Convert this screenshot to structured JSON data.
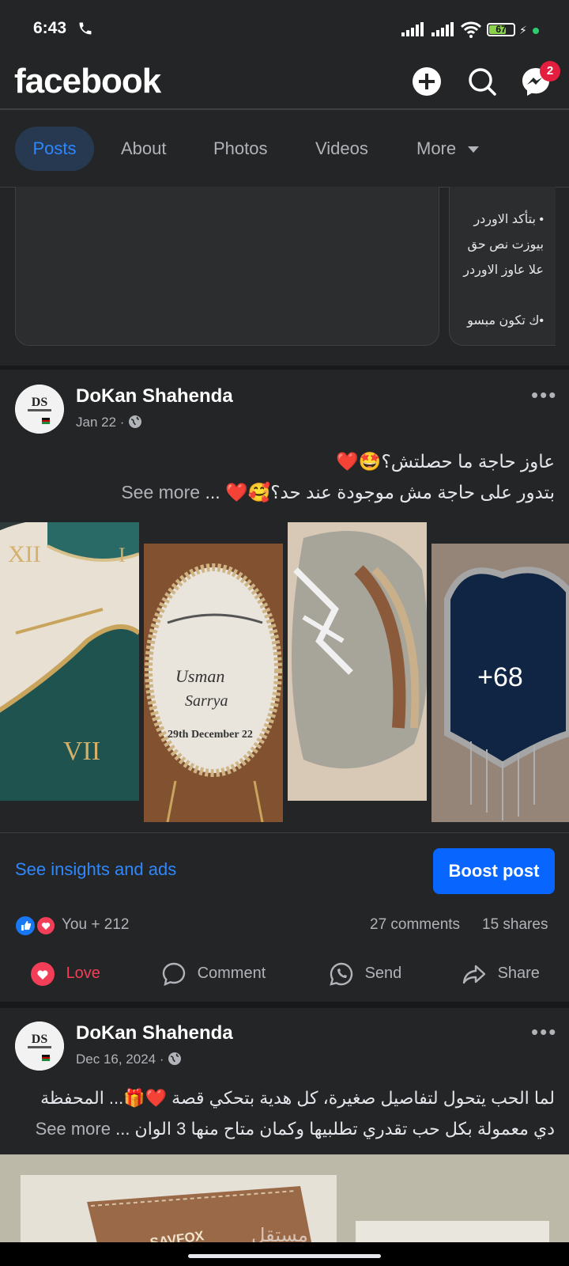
{
  "status_bar": {
    "time": "6:43",
    "battery": "67"
  },
  "header": {
    "logo": "facebook",
    "messenger_badge": "2"
  },
  "tabs": [
    {
      "label": "Posts"
    },
    {
      "label": "About"
    },
    {
      "label": "Photos"
    },
    {
      "label": "Videos"
    },
    {
      "label": "More"
    }
  ],
  "top_card": {
    "text": "• بتأكد الاوردر\nبيوزت نص حق\nعلا عاوز الاوردر\n\n•ك تكون مبسو"
  },
  "post1": {
    "author": "DoKan Shahenda",
    "date": "Jan 22",
    "line1": "عاوز حاجة ما حصلتش؟🤩❤️",
    "line2": "بتدور على حاجة مش موجودة عند حد؟🥰❤️",
    "see_more": "See more",
    "ellipsis": "...",
    "more_photos": "+68",
    "insights": "See insights and ads",
    "boost": "Boost post",
    "reactions": "You + 212",
    "comments": "27 comments",
    "shares": "15 shares",
    "actions": {
      "love": "Love",
      "comment": "Comment",
      "send": "Send",
      "share": "Share"
    }
  },
  "post2": {
    "author": "DoKan Shahenda",
    "date": "Dec 16, 2024",
    "line1": "لما الحب يتحول لتفاصيل صغيرة، كل هدية بتحكي قصة ❤️🎁... المحفظة",
    "line2": "دي معمولة بكل حب تقدري تطلبيها وكمان متاح منها 3 الوان ...",
    "see_more": "See more"
  },
  "colors": {
    "accent": "#2d88ff",
    "boost": "#0866ff",
    "love": "#f33e58",
    "bg": "#242526"
  }
}
